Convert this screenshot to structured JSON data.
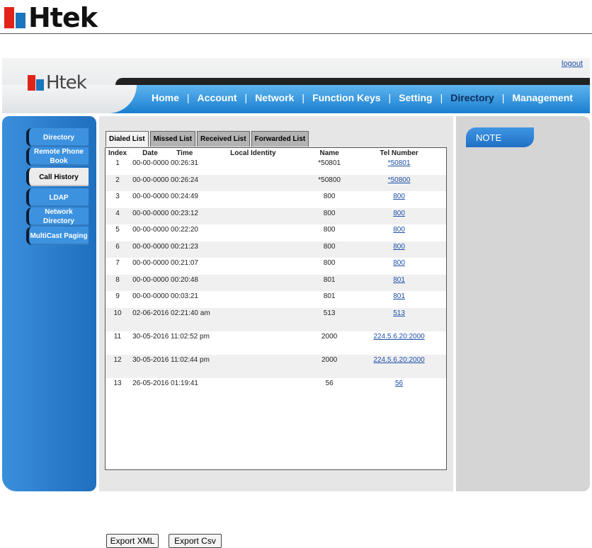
{
  "brand": {
    "logo_text": "Htek"
  },
  "header": {
    "logo_text": "Htek",
    "logout_label": "logout",
    "nav": [
      {
        "label": "Home"
      },
      {
        "label": "Account"
      },
      {
        "label": "Network"
      },
      {
        "label": "Function Keys"
      },
      {
        "label": "Setting"
      },
      {
        "label": "Directory",
        "active": true
      },
      {
        "label": "Management"
      }
    ]
  },
  "sidebar": {
    "items": [
      {
        "label": "Directory"
      },
      {
        "label": "Remote Phone Book"
      },
      {
        "label": "Call History",
        "active": true
      },
      {
        "label": "LDAP"
      },
      {
        "label": "Network Directory"
      },
      {
        "label": "MultiCast Paging"
      }
    ]
  },
  "tabs": [
    {
      "label": "Dialed List",
      "active": true
    },
    {
      "label": "Missed List"
    },
    {
      "label": "Received List"
    },
    {
      "label": "Forwarded List"
    }
  ],
  "table": {
    "headers": {
      "index": "Index",
      "date": "Date",
      "time": "Time",
      "local_identity": "Local Identity",
      "name": "Name",
      "tel": "Tel Number"
    },
    "rows": [
      {
        "index": "1",
        "datetime": "00-00-0000 00:26:31",
        "local_identity": "",
        "name": "*50801",
        "tel": "*50801"
      },
      {
        "index": "2",
        "datetime": "00-00-0000 00:26:24",
        "local_identity": "",
        "name": "*50800",
        "tel": "*50800"
      },
      {
        "index": "3",
        "datetime": "00-00-0000 00:24:49",
        "local_identity": "",
        "name": "800",
        "tel": "800"
      },
      {
        "index": "4",
        "datetime": "00-00-0000 00:23:12",
        "local_identity": "",
        "name": "800",
        "tel": "800"
      },
      {
        "index": "5",
        "datetime": "00-00-0000 00:22:20",
        "local_identity": "",
        "name": "800",
        "tel": "800"
      },
      {
        "index": "6",
        "datetime": "00-00-0000 00:21:23",
        "local_identity": "",
        "name": "800",
        "tel": "800"
      },
      {
        "index": "7",
        "datetime": "00-00-0000 00:21:07",
        "local_identity": "",
        "name": "800",
        "tel": "800"
      },
      {
        "index": "8",
        "datetime": "00-00-0000 00:20:48",
        "local_identity": "",
        "name": "801",
        "tel": "801"
      },
      {
        "index": "9",
        "datetime": "00-00-0000 00:03:21",
        "local_identity": "",
        "name": "801",
        "tel": "801"
      },
      {
        "index": "10",
        "datetime": "02-06-2016 02:21:40 am",
        "local_identity": "",
        "name": "513",
        "tel": "513"
      },
      {
        "index": "11",
        "datetime": "30-05-2016 11:02:52 pm",
        "local_identity": "",
        "name": "2000",
        "tel": "224.5.6.20:2000"
      },
      {
        "index": "12",
        "datetime": "30-05-2016 11:02:44 pm",
        "local_identity": "",
        "name": "2000",
        "tel": "224.5.6.20:2000"
      },
      {
        "index": "13",
        "datetime": "26-05-2016 01:19:41",
        "local_identity": "",
        "name": "56",
        "tel": "56"
      }
    ]
  },
  "buttons": {
    "export_xml": "Export XML",
    "export_csv": "Export Csv"
  },
  "note": {
    "title": "NOTE"
  },
  "colors": {
    "nav_blue": "#1a7fd0",
    "sidebar_blue": "#3a8fdb",
    "brand_red": "#e2231a",
    "link": "#1b4fa8"
  }
}
